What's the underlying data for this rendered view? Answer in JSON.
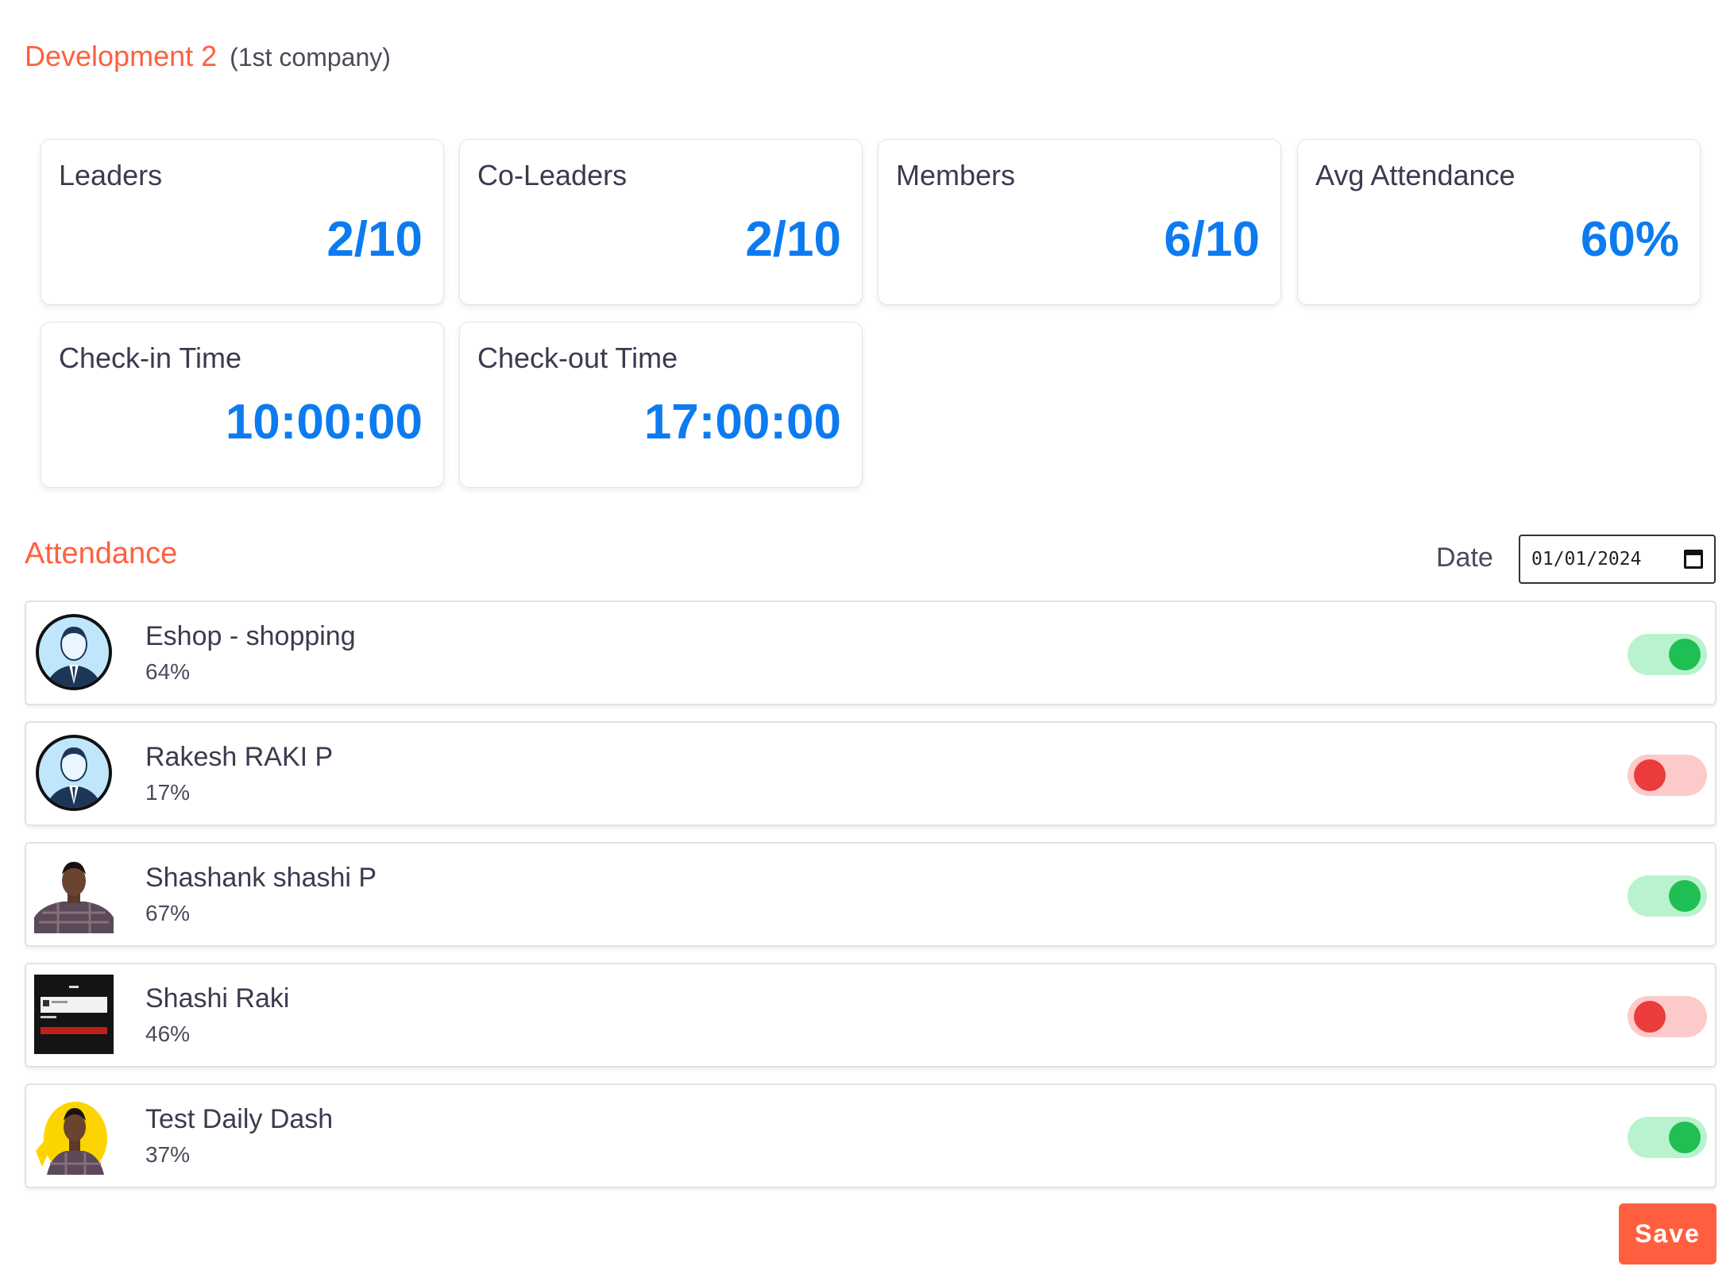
{
  "header": {
    "team_name": "Development 2",
    "company": "(1st company)"
  },
  "stats": [
    {
      "label": "Leaders",
      "value": "2/10"
    },
    {
      "label": "Co-Leaders",
      "value": "2/10"
    },
    {
      "label": "Members",
      "value": "6/10"
    },
    {
      "label": "Avg Attendance",
      "value": "60%"
    },
    {
      "label": "Check-in Time",
      "value": "10:00:00"
    },
    {
      "label": "Check-out Time",
      "value": "17:00:00"
    }
  ],
  "attendance": {
    "title": "Attendance",
    "date_label": "Date",
    "date_value": "01/01/2024",
    "members": [
      {
        "name": "Eshop - shopping",
        "percent": "64%",
        "present": true,
        "avatar": "default-user-avatar"
      },
      {
        "name": "Rakesh RAKI P",
        "percent": "17%",
        "present": false,
        "avatar": "default-user-avatar"
      },
      {
        "name": "Shashank shashi P",
        "percent": "67%",
        "present": true,
        "avatar": "photo-avatar"
      },
      {
        "name": "Shashi Raki",
        "percent": "46%",
        "present": false,
        "avatar": "screenshot-avatar"
      },
      {
        "name": "Test Daily Dash",
        "percent": "37%",
        "present": true,
        "avatar": "photo-avatar-yellow"
      }
    ]
  },
  "save_label": "Save",
  "colors": {
    "accent": "#ff5f3f",
    "value_blue": "#0d7bf0",
    "toggle_on": "#1fbf54",
    "toggle_off": "#ec3b3b"
  }
}
